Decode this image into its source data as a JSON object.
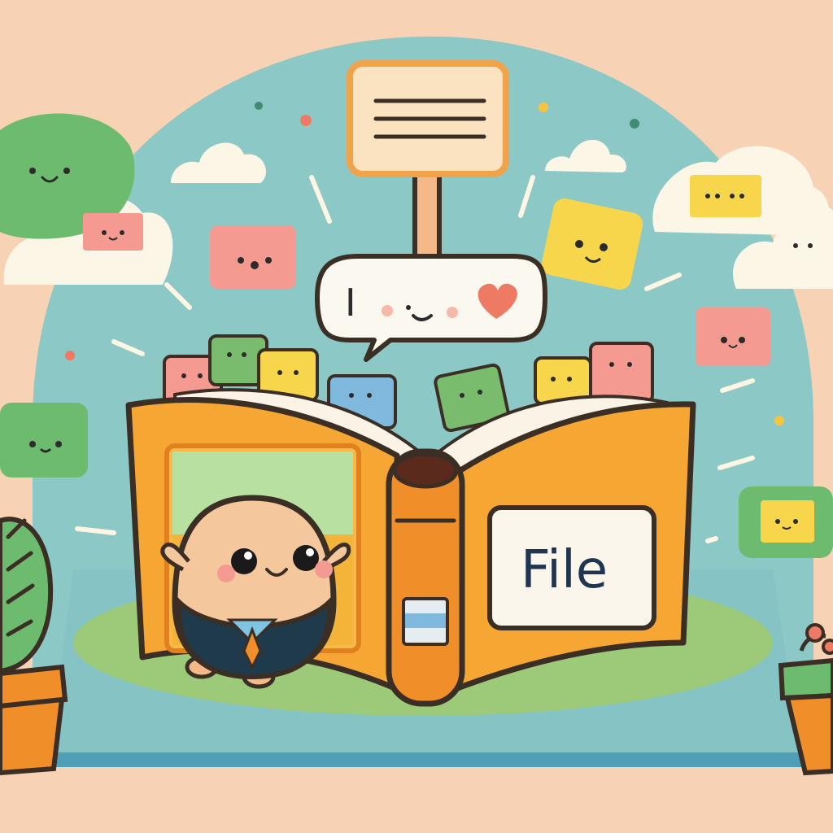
{
  "scene": {
    "book_label": "File",
    "speech_bubble_text": "I",
    "colors": {
      "background": "#f8d2b4",
      "sky": "#8cc8c6",
      "grass": "#9cca79",
      "book_orange": "#f6a632",
      "outline": "#3b2e25",
      "card_pink": "#f59a90",
      "card_yellow": "#f7d64b",
      "card_green": "#79bc6d",
      "card_blue": "#7fb9de",
      "heart": "#ef7a64"
    },
    "icons": [
      "signpost-icon",
      "speech-bubble-icon",
      "heart-icon",
      "smiley-card-icon",
      "cloud-icon",
      "potted-plant-icon",
      "mascot-character-icon"
    ]
  }
}
